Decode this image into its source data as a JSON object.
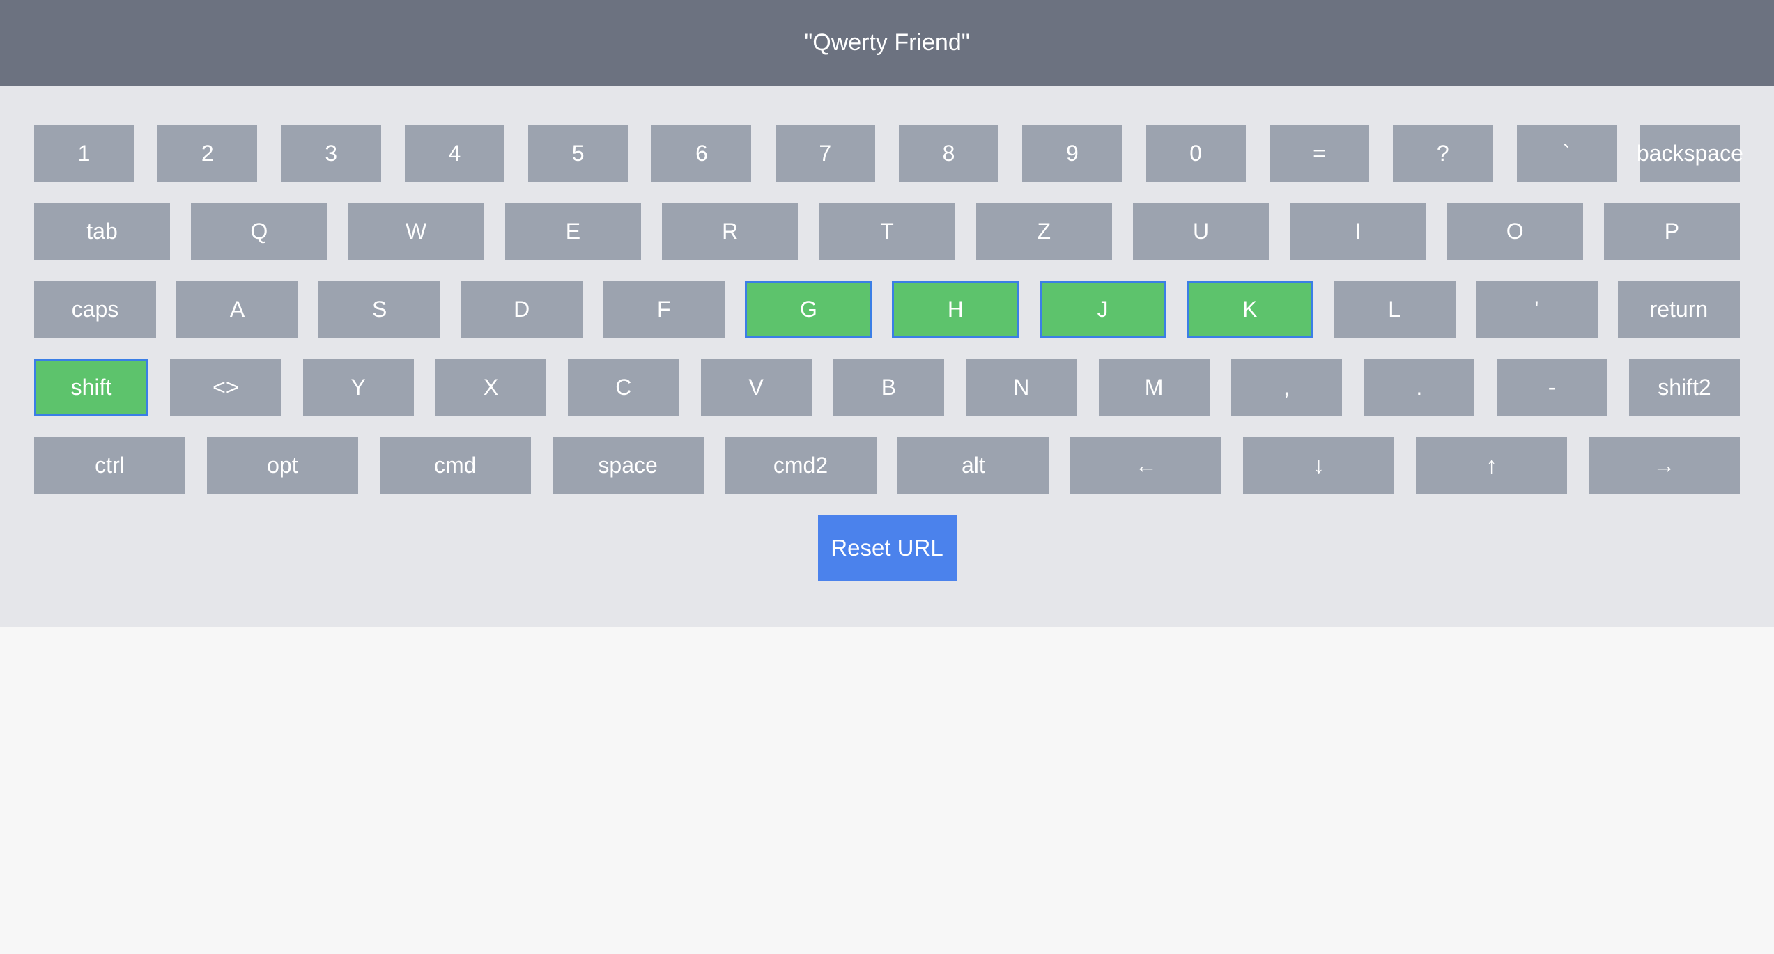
{
  "header": {
    "title": "\"Qwerty Friend\""
  },
  "keyboard": {
    "rows": [
      {
        "keys": [
          {
            "label": "1",
            "active": false
          },
          {
            "label": "2",
            "active": false
          },
          {
            "label": "3",
            "active": false
          },
          {
            "label": "4",
            "active": false
          },
          {
            "label": "5",
            "active": false
          },
          {
            "label": "6",
            "active": false
          },
          {
            "label": "7",
            "active": false
          },
          {
            "label": "8",
            "active": false
          },
          {
            "label": "9",
            "active": false
          },
          {
            "label": "0",
            "active": false
          },
          {
            "label": "=",
            "active": false
          },
          {
            "label": "?",
            "active": false
          },
          {
            "label": "`",
            "active": false
          },
          {
            "label": "backspace",
            "active": false
          }
        ]
      },
      {
        "keys": [
          {
            "label": "tab",
            "active": false
          },
          {
            "label": "Q",
            "active": false
          },
          {
            "label": "W",
            "active": false
          },
          {
            "label": "E",
            "active": false
          },
          {
            "label": "R",
            "active": false
          },
          {
            "label": "T",
            "active": false
          },
          {
            "label": "Z",
            "active": false
          },
          {
            "label": "U",
            "active": false
          },
          {
            "label": "I",
            "active": false
          },
          {
            "label": "O",
            "active": false
          },
          {
            "label": "P",
            "active": false
          }
        ]
      },
      {
        "keys": [
          {
            "label": "caps",
            "active": false
          },
          {
            "label": "A",
            "active": false
          },
          {
            "label": "S",
            "active": false
          },
          {
            "label": "D",
            "active": false
          },
          {
            "label": "F",
            "active": false
          },
          {
            "label": "G",
            "active": true
          },
          {
            "label": "H",
            "active": true
          },
          {
            "label": "J",
            "active": true
          },
          {
            "label": "K",
            "active": true
          },
          {
            "label": "L",
            "active": false
          },
          {
            "label": "'",
            "active": false
          },
          {
            "label": "return",
            "active": false
          }
        ]
      },
      {
        "keys": [
          {
            "label": "shift",
            "active": true
          },
          {
            "label": "<>",
            "active": false
          },
          {
            "label": "Y",
            "active": false
          },
          {
            "label": "X",
            "active": false
          },
          {
            "label": "C",
            "active": false
          },
          {
            "label": "V",
            "active": false
          },
          {
            "label": "B",
            "active": false
          },
          {
            "label": "N",
            "active": false
          },
          {
            "label": "M",
            "active": false
          },
          {
            "label": ",",
            "active": false
          },
          {
            "label": ".",
            "active": false
          },
          {
            "label": "-",
            "active": false
          },
          {
            "label": "shift2",
            "active": false
          }
        ]
      },
      {
        "keys": [
          {
            "label": "ctrl",
            "active": false
          },
          {
            "label": "opt",
            "active": false
          },
          {
            "label": "cmd",
            "active": false
          },
          {
            "label": "space",
            "active": false
          },
          {
            "label": "cmd2",
            "active": false
          },
          {
            "label": "alt",
            "active": false
          },
          {
            "label": "←",
            "active": false
          },
          {
            "label": "↓",
            "active": false
          },
          {
            "label": "↑",
            "active": false
          },
          {
            "label": "→",
            "active": false
          }
        ]
      }
    ]
  },
  "reset_button": {
    "label": "Reset URL"
  },
  "colors": {
    "key_default": "#9ca3af",
    "key_active": "#5dc36c",
    "key_active_border": "#3b7ee6",
    "header_bg": "#6c7280",
    "button_bg": "#4b82ec"
  }
}
